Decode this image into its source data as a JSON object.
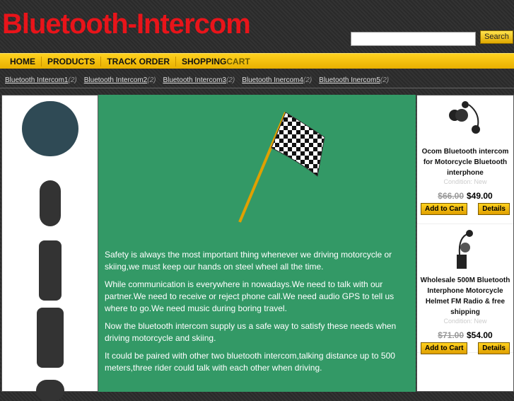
{
  "site": {
    "title": "Bluetooth-Intercom"
  },
  "search": {
    "button": "Search",
    "placeholder": ""
  },
  "nav": [
    {
      "label": "HOME"
    },
    {
      "label": "PRODUCTS"
    },
    {
      "label": "TRACK ORDER"
    },
    {
      "a": "SHOPPING",
      "b": "CART"
    }
  ],
  "categories": [
    {
      "label": "Bluetooth Intercom1",
      "count": "(2)"
    },
    {
      "label": "Bluetooth Intercom2",
      "count": "(2)"
    },
    {
      "label": "Bluetooth Intercom3",
      "count": "(2)"
    },
    {
      "label": "Bluetooth Inercom4",
      "count": "(2)"
    },
    {
      "label": "Bluetooth Inercom5",
      "count": "(2)"
    }
  ],
  "main": {
    "paragraphs": [
      "Safety is always the most important thing whenever we driving motorcycle or skiing,we must keep our hands on steel wheel all the time.",
      "While communication is everywhere in nowadays.We need to talk with our partner.We need to receive or reject phone call.We need audio GPS to tell us where to go.We need music during boring travel.",
      "Now the bluetooth intercom supply us a safe way to satisfy these needs when driving motorcycle and skiing.",
      "It could be paired with other two bluetooth intercom,talking distance up to 500 meters,three rider could talk with each other when driving."
    ]
  },
  "products": [
    {
      "title": "Ocom Bluetooth intercom for Motorcycle Bluetooth interphone",
      "condition": "Condition: New",
      "old_price": "$66.00",
      "price": "$49.00",
      "cart": "Add to Cart",
      "details": "Details"
    },
    {
      "title": "Wholesale 500M Bluetooth Interphone Motorcycle Helmet FM Radio & free shipping",
      "condition": "Condition: New",
      "old_price": "$71.00",
      "price": "$54.00",
      "cart": "Add to Cart",
      "details": "Details"
    }
  ]
}
